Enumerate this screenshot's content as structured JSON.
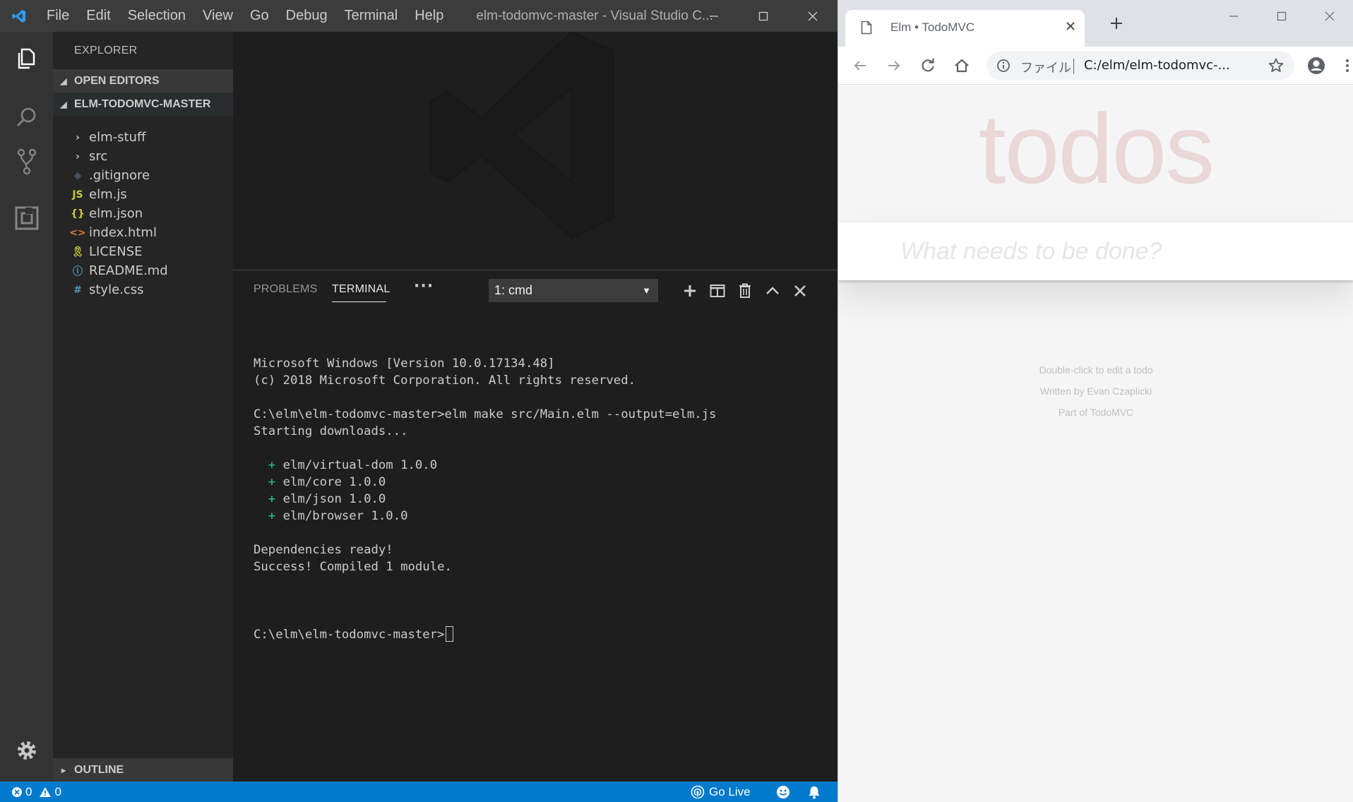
{
  "vscode": {
    "menu": [
      "File",
      "Edit",
      "Selection",
      "View",
      "Go",
      "Debug",
      "Terminal",
      "Help"
    ],
    "window_title": "elm-todomvc-master - Visual Studio C...",
    "sidebar": {
      "title": "EXPLORER",
      "open_editors": "OPEN EDITORS",
      "folder": "ELM-TODOMVC-MASTER",
      "items": [
        {
          "label": "elm-stuff",
          "icon": "chevron-right-icon",
          "icon_text": "›",
          "color": "#c5c5c5"
        },
        {
          "label": "src",
          "icon": "chevron-right-icon",
          "icon_text": "›",
          "color": "#c5c5c5"
        },
        {
          "label": ".gitignore",
          "icon": "git-diamond-icon",
          "icon_text": "◆",
          "color": "#41535b"
        },
        {
          "label": "elm.js",
          "icon": "javascript-icon",
          "icon_text": "JS",
          "color": "#cbcb41"
        },
        {
          "label": "elm.json",
          "icon": "json-braces-icon",
          "icon_text": "{}",
          "color": "#cbcb41"
        },
        {
          "label": "index.html",
          "icon": "html-brackets-icon",
          "icon_text": "<>",
          "color": "#e37933"
        },
        {
          "label": "LICENSE",
          "icon": "license-ribbon-icon",
          "icon_text": "🎗",
          "color": "#cbcb41"
        },
        {
          "label": "README.md",
          "icon": "info-circle-icon",
          "icon_text": "ⓘ",
          "color": "#519aba"
        },
        {
          "label": "style.css",
          "icon": "hash-icon",
          "icon_text": "#",
          "color": "#519aba"
        }
      ],
      "outline": "OUTLINE"
    },
    "panel": {
      "tabs": {
        "problems": "PROBLEMS",
        "terminal": "TERMINAL",
        "more": "···"
      },
      "terminal_select": "1: cmd",
      "terminal_lines": [
        {
          "text": "Microsoft Windows [Version 10.0.17134.48]"
        },
        {
          "text": "(c) 2018 Microsoft Corporation. All rights reserved."
        },
        {
          "text": ""
        },
        {
          "text": "C:\\elm\\elm-todomvc-master>elm make src/Main.elm --output=elm.js"
        },
        {
          "text": "Starting downloads..."
        },
        {
          "text": ""
        },
        {
          "plus": "  + ",
          "text": "elm/virtual-dom 1.0.0"
        },
        {
          "plus": "  + ",
          "text": "elm/core 1.0.0"
        },
        {
          "plus": "  + ",
          "text": "elm/json 1.0.0"
        },
        {
          "plus": "  + ",
          "text": "elm/browser 1.0.0"
        },
        {
          "text": ""
        },
        {
          "text": "Dependencies ready!"
        },
        {
          "text": "Success! Compiled 1 module."
        },
        {
          "text": ""
        }
      ],
      "prompt": "C:\\elm\\elm-todomvc-master>"
    },
    "statusbar": {
      "errors": "0",
      "warnings": "0",
      "go_live": "Go Live"
    },
    "colors": {
      "statusbar": "#007acc",
      "activity": "#333333",
      "sidebar": "#252526"
    }
  },
  "chrome": {
    "tab_title": "Elm • TodoMVC",
    "omnibox": {
      "security_label": "ファイル",
      "url": "C:/elm/elm-todomvc-..."
    },
    "page": {
      "heading": "todos",
      "input_placeholder": "What needs to be done?",
      "footer": [
        "Double-click to edit a todo",
        "Written by Evan Czaplicki",
        "Part of TodoMVC"
      ]
    }
  }
}
